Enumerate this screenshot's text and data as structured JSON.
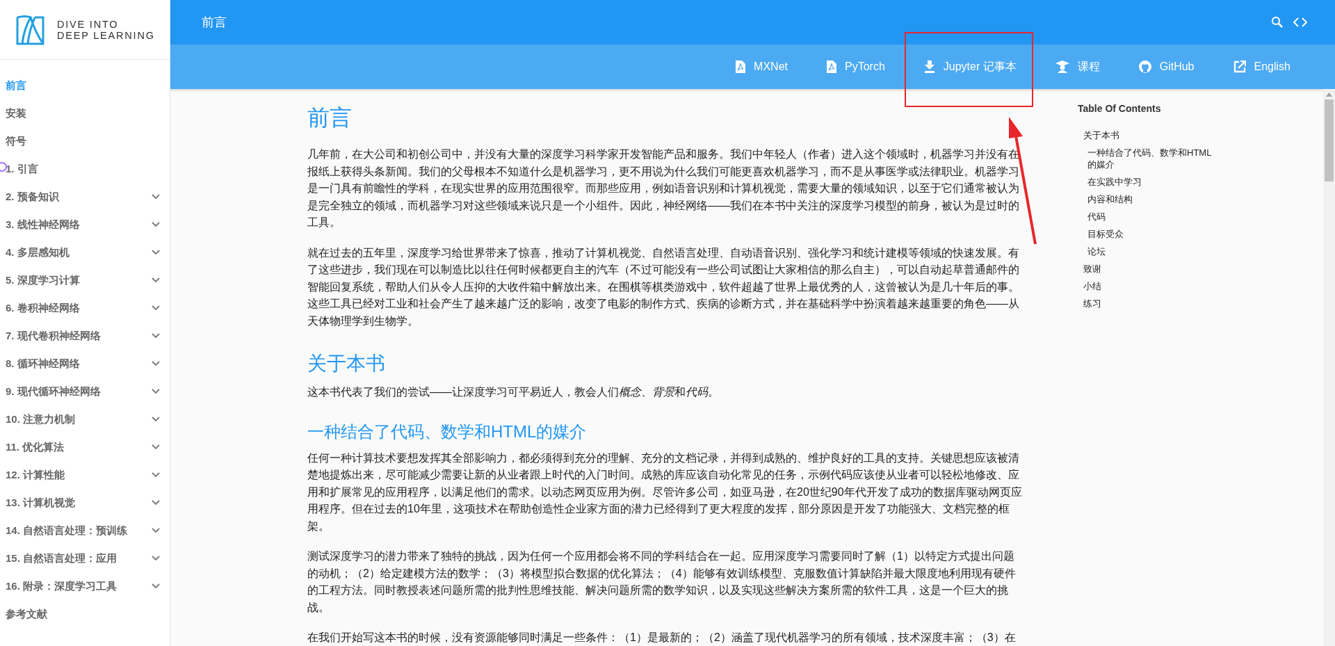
{
  "logo": {
    "line1": "DIVE INTO",
    "line2": "DEEP LEARNING"
  },
  "sidebar": {
    "items": [
      {
        "label": "前言",
        "selected": true,
        "expandable": false
      },
      {
        "label": "安装",
        "selected": false,
        "expandable": false
      },
      {
        "label": "符号",
        "selected": false,
        "expandable": false
      },
      {
        "label": "1. 引言",
        "selected": false,
        "expandable": false
      },
      {
        "label": "2. 预备知识",
        "selected": false,
        "expandable": true
      },
      {
        "label": "3. 线性神经网络",
        "selected": false,
        "expandable": true
      },
      {
        "label": "4. 多层感知机",
        "selected": false,
        "expandable": true
      },
      {
        "label": "5. 深度学习计算",
        "selected": false,
        "expandable": true
      },
      {
        "label": "6. 卷积神经网络",
        "selected": false,
        "expandable": true
      },
      {
        "label": "7. 现代卷积神经网络",
        "selected": false,
        "expandable": true
      },
      {
        "label": "8. 循环神经网络",
        "selected": false,
        "expandable": true
      },
      {
        "label": "9. 现代循环神经网络",
        "selected": false,
        "expandable": true
      },
      {
        "label": "10. 注意力机制",
        "selected": false,
        "expandable": true
      },
      {
        "label": "11. 优化算法",
        "selected": false,
        "expandable": true
      },
      {
        "label": "12. 计算性能",
        "selected": false,
        "expandable": true
      },
      {
        "label": "13. 计算机视觉",
        "selected": false,
        "expandable": true
      },
      {
        "label": "14. 自然语言处理：预训练",
        "selected": false,
        "expandable": true
      },
      {
        "label": "15. 自然语言处理：应用",
        "selected": false,
        "expandable": true
      },
      {
        "label": "16. 附录：深度学习工具",
        "selected": false,
        "expandable": true
      },
      {
        "label": "参考文献",
        "selected": false,
        "expandable": false
      }
    ]
  },
  "header": {
    "title": "前言"
  },
  "nav_links": [
    {
      "label": "MXNet",
      "kind": "pdf"
    },
    {
      "label": "PyTorch",
      "kind": "pdf"
    },
    {
      "label": "Jupyter 记事本",
      "kind": "download"
    },
    {
      "label": "课程",
      "kind": "course"
    },
    {
      "label": "GitHub",
      "kind": "github"
    },
    {
      "label": "English",
      "kind": "external"
    }
  ],
  "content": [
    {
      "kind": "h1",
      "text": "前言"
    },
    {
      "kind": "p",
      "text": "几年前，在大公司和初创公司中，并没有大量的深度学习科学家开发智能产品和服务。我们中年轻人（作者）进入这个领域时，机器学习并没有在报纸上获得头条新闻。我们的父母根本不知道什么是机器学习，更不用说为什么我们可能更喜欢机器学习，而不是从事医学或法律职业。机器学习是一门具有前瞻性的学科，在现实世界的应用范围很窄。而那些应用，例如语音识别和计算机视觉，需要大量的领域知识，以至于它们通常被认为是完全独立的领域，而机器学习对这些领域来说只是一个小组件。因此，神经网络——我们在本书中关注的深度学习模型的前身，被认为是过时的工具。"
    },
    {
      "kind": "p",
      "text": "就在过去的五年里，深度学习给世界带来了惊喜，推动了计算机视觉、自然语言处理、自动语音识别、强化学习和统计建模等领域的快速发展。有了这些进步，我们现在可以制造比以往任何时候都更自主的汽车（不过可能没有一些公司试图让大家相信的那么自主），可以自动起草普通邮件的智能回复系统，帮助人们从令人压抑的大收件箱中解放出来。在围棋等棋类游戏中，软件超越了世界上最优秀的人，这曾被认为是几十年后的事。这些工具已经对工业和社会产生了越来越广泛的影响，改变了电影的制作方式、疾病的诊断方式，并在基础科学中扮演着越来越重要的角色——从天体物理学到生物学。"
    },
    {
      "kind": "h2",
      "text": "关于本书"
    },
    {
      "kind": "mixed",
      "parts": [
        {
          "text": "这本书代表了我们的尝试——让深度学习可平易近人，教会人们",
          "italic": false
        },
        {
          "text": "概念",
          "italic": true
        },
        {
          "text": "、",
          "italic": false
        },
        {
          "text": "背景",
          "italic": true
        },
        {
          "text": "和",
          "italic": false
        },
        {
          "text": "代码",
          "italic": true
        },
        {
          "text": "。",
          "italic": false
        }
      ]
    },
    {
      "kind": "h3",
      "text": "一种结合了代码、数学和HTML的媒介"
    },
    {
      "kind": "p",
      "text": "任何一种计算技术要想发挥其全部影响力，都必须得到充分的理解、充分的文档记录，并得到成熟的、维护良好的工具的支持。关键思想应该被清楚地提炼出来，尽可能减少需要让新的从业者跟上时代的入门时间。成熟的库应该自动化常见的任务，示例代码应该使从业者可以轻松地修改、应用和扩展常见的应用程序，以满足他们的需求。以动态网页应用为例。尽管许多公司，如亚马逊，在20世纪90年代开发了成功的数据库驱动网页应用程序。但在过去的10年里，这项技术在帮助创造性企业家方面的潜力已经得到了更大程度的发挥，部分原因是开发了功能强大、文档完整的框架。"
    },
    {
      "kind": "p",
      "text": "测试深度学习的潜力带来了独特的挑战，因为任何一个应用都会将不同的学科结合在一起。应用深度学习需要同时了解（1）以特定方式提出问题的动机；（2）给定建模方法的数学；（3）将模型拟合数据的优化算法；（4）能够有效训练模型、克服数值计算缺陷并最大限度地利用现有硬件的工程方法。同时教授表述问题所需的批判性思维技能、解决问题所需的数学知识，以及实现这些解决方案所需的软件工具，这是一个巨大的挑战。"
    },
    {
      "kind": "p",
      "text": "在我们开始写这本书的时候，没有资源能够同时满足一些条件：（1）是最新的；（2）涵盖了现代机器学习的所有领域，技术深度丰富；（3）在"
    }
  ],
  "toc": {
    "title": "Table Of Contents",
    "items": [
      {
        "label": "关于本书",
        "children": [
          {
            "label": "一种结合了代码、数学和HTML的媒介"
          },
          {
            "label": "在实践中学习"
          },
          {
            "label": "内容和结构"
          },
          {
            "label": "代码"
          },
          {
            "label": "目标受众"
          },
          {
            "label": "论坛"
          }
        ]
      },
      {
        "label": "致谢"
      },
      {
        "label": "小结"
      },
      {
        "label": "练习"
      }
    ]
  }
}
